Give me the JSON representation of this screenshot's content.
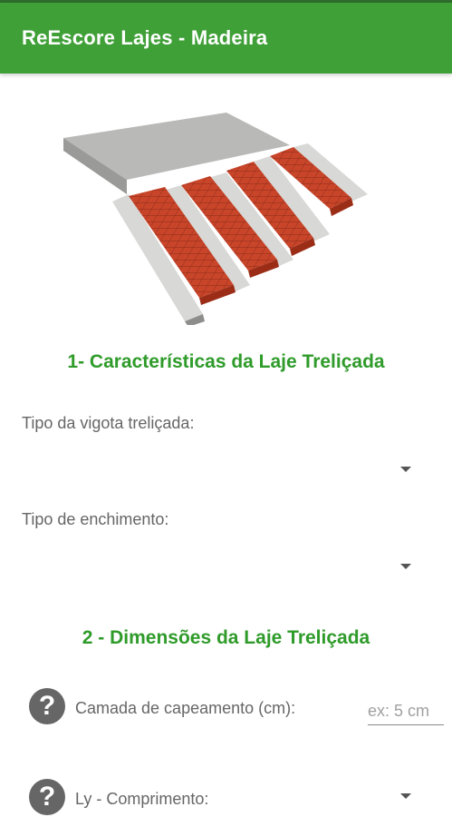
{
  "app": {
    "title": "ReEscore Lajes - Madeira"
  },
  "colors": {
    "appbar": "#40a038",
    "statusbar": "#2e6b2c",
    "section_title": "#2f9b2a",
    "label": "#666666"
  },
  "illustration": {
    "icon": "lattice-slab-illustration"
  },
  "section1": {
    "title": "1- Características da Laje Treliçada",
    "joist_type_label": "Tipo da vigota treliçada:",
    "joist_type_value": "",
    "filler_type_label": "Tipo de enchimento:",
    "filler_type_value": ""
  },
  "section2": {
    "title": "2 - Dimensões da Laje Treliçada",
    "topping": {
      "icon": "help-icon",
      "help_glyph": "?",
      "label": "Camada de capeamento (cm):",
      "value": "",
      "placeholder": "ex: 5 cm"
    },
    "ly": {
      "icon": "help-icon",
      "help_glyph": "?",
      "label": "Ly - Comprimento:",
      "value": ""
    }
  }
}
